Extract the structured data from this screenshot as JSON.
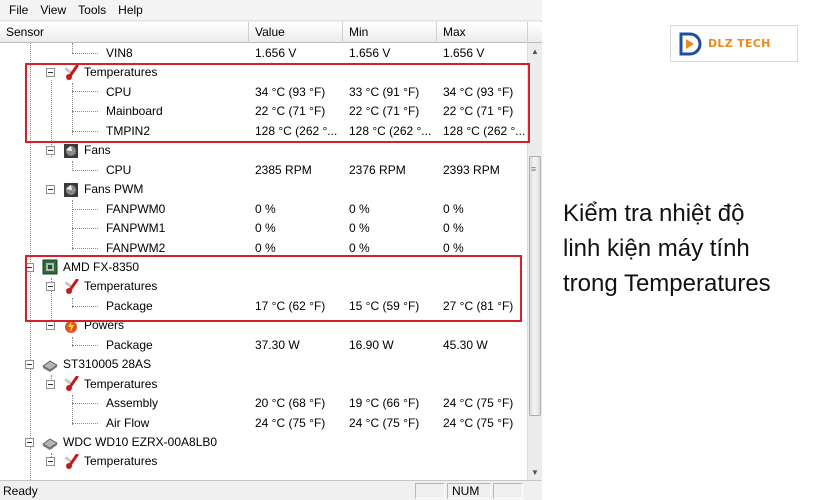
{
  "menu": {
    "file": "File",
    "view": "View",
    "tools": "Tools",
    "help": "Help"
  },
  "columns": {
    "sensor": "Sensor",
    "value": "Value",
    "min": "Min",
    "max": "Max"
  },
  "rows": [
    {
      "label": "VIN8",
      "value": "1.656 V",
      "min": "1.656 V",
      "max": "1.656 V"
    },
    {
      "label": "Temperatures"
    },
    {
      "label": "CPU",
      "value": "34 °C  (93 °F)",
      "min": "33 °C  (91 °F)",
      "max": "34 °C  (93 °F)"
    },
    {
      "label": "Mainboard",
      "value": "22 °C  (71 °F)",
      "min": "22 °C  (71 °F)",
      "max": "22 °C  (71 °F)"
    },
    {
      "label": "TMPIN2",
      "value": "128 °C  (262 °...",
      "min": "128 °C  (262 °...",
      "max": "128 °C  (262 °..."
    },
    {
      "label": "Fans"
    },
    {
      "label": "CPU",
      "value": "2385 RPM",
      "min": "2376 RPM",
      "max": "2393 RPM"
    },
    {
      "label": "Fans PWM"
    },
    {
      "label": "FANPWM0",
      "value": "0 %",
      "min": "0 %",
      "max": "0 %"
    },
    {
      "label": "FANPWM1",
      "value": "0 %",
      "min": "0 %",
      "max": "0 %"
    },
    {
      "label": "FANPWM2",
      "value": "0 %",
      "min": "0 %",
      "max": "0 %"
    },
    {
      "label": "AMD FX-8350"
    },
    {
      "label": "Temperatures"
    },
    {
      "label": "Package",
      "value": "17 °C  (62 °F)",
      "min": "15 °C  (59 °F)",
      "max": "27 °C  (81 °F)"
    },
    {
      "label": "Powers"
    },
    {
      "label": "Package",
      "value": "37.30 W",
      "min": "16.90 W",
      "max": "45.30 W"
    },
    {
      "label": "ST310005 28AS"
    },
    {
      "label": "Temperatures"
    },
    {
      "label": "Assembly",
      "value": "20 °C  (68 °F)",
      "min": "19 °C  (66 °F)",
      "max": "24 °C  (75 °F)"
    },
    {
      "label": "Air Flow",
      "value": "24 °C  (75 °F)",
      "min": "24 °C  (75 °F)",
      "max": "24 °C  (75 °F)"
    },
    {
      "label": "WDC WD10 EZRX-00A8LB0"
    },
    {
      "label": "Temperatures"
    }
  ],
  "status": {
    "text": "Ready",
    "num": "NUM"
  },
  "logo": {
    "brand": "DLZ TECH"
  },
  "caption": {
    "line1": "Kiểm tra nhiệt độ",
    "line2": "linh kiện máy tính",
    "line3": "trong Temperatures"
  },
  "colors": {
    "highlight": "#d7202e",
    "brand_orange": "#e98a1c",
    "brand_blue": "#1d4f9c"
  }
}
